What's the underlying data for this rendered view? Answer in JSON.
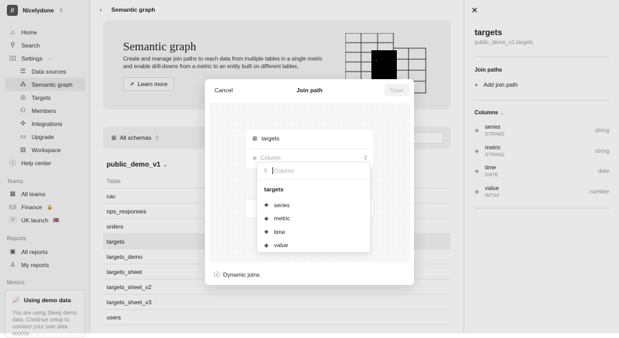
{
  "sidebar": {
    "workspace": "Nicelydone",
    "items": [
      {
        "label": "Home",
        "icon": "home-icon"
      },
      {
        "label": "Search",
        "icon": "search-icon"
      },
      {
        "label": "Settings",
        "icon": "settings-icon"
      },
      {
        "label": "Data sources",
        "icon": "database-icon"
      },
      {
        "label": "Semantic graph",
        "icon": "graph-icon"
      },
      {
        "label": "Targets",
        "icon": "target-icon"
      },
      {
        "label": "Members",
        "icon": "members-icon"
      },
      {
        "label": "Integrations",
        "icon": "integrations-icon"
      },
      {
        "label": "Upgrade",
        "icon": "card-icon"
      },
      {
        "label": "Workspace",
        "icon": "workspace-icon"
      },
      {
        "label": "Help center",
        "icon": "help-icon"
      }
    ],
    "teams_label": "Teams",
    "teams": [
      {
        "label": "All teams"
      },
      {
        "label": "Finance",
        "badge": "F"
      },
      {
        "label": "UK launch",
        "badge": "U",
        "flag": "🇬🇧"
      }
    ],
    "reports_label": "Reports",
    "reports": [
      {
        "label": "All reports"
      },
      {
        "label": "My reports"
      }
    ],
    "metrics_label": "Metrics",
    "demo": {
      "title": "Using demo data",
      "desc": "You are using Steep demo data. Continue setup to connect your own data source."
    }
  },
  "main": {
    "breadcrumb": "Semantic graph",
    "hero": {
      "title": "Semantic graph",
      "desc": "Create and manage join paths to reach data from multiple tables in a single metric and enable drill-downs from a metric to an entity built on different tables.",
      "button": "Learn more"
    },
    "schema_select": "All schemas",
    "database": "public_demo_v1",
    "table_header": "Table",
    "tables": [
      "cac",
      "nps_responses",
      "orders",
      "targets",
      "targets_demo",
      "targets_sheet",
      "targets_sheet_v2",
      "targets_sheet_v3",
      "users"
    ]
  },
  "right": {
    "title": "targets",
    "subtitle": "public_demo_v1.targets",
    "join_paths_label": "Join paths",
    "add_join": "Add join path",
    "columns_label": "Columns",
    "columns": [
      {
        "name": "series",
        "dtype": "STRING",
        "type": "string"
      },
      {
        "name": "metric",
        "dtype": "STRING",
        "type": "string"
      },
      {
        "name": "time",
        "dtype": "DATE",
        "type": "date"
      },
      {
        "name": "value",
        "dtype": "INT64",
        "type": "number"
      }
    ]
  },
  "modal": {
    "cancel": "Cancel",
    "title": "Join path",
    "save": "Save",
    "node_table": "targets",
    "column_placeholder": "Column",
    "search_placeholder": "Column",
    "group": "targets",
    "options": [
      "series",
      "metric",
      "time",
      "value"
    ],
    "dynamic_joins": "Dynamic joins"
  }
}
